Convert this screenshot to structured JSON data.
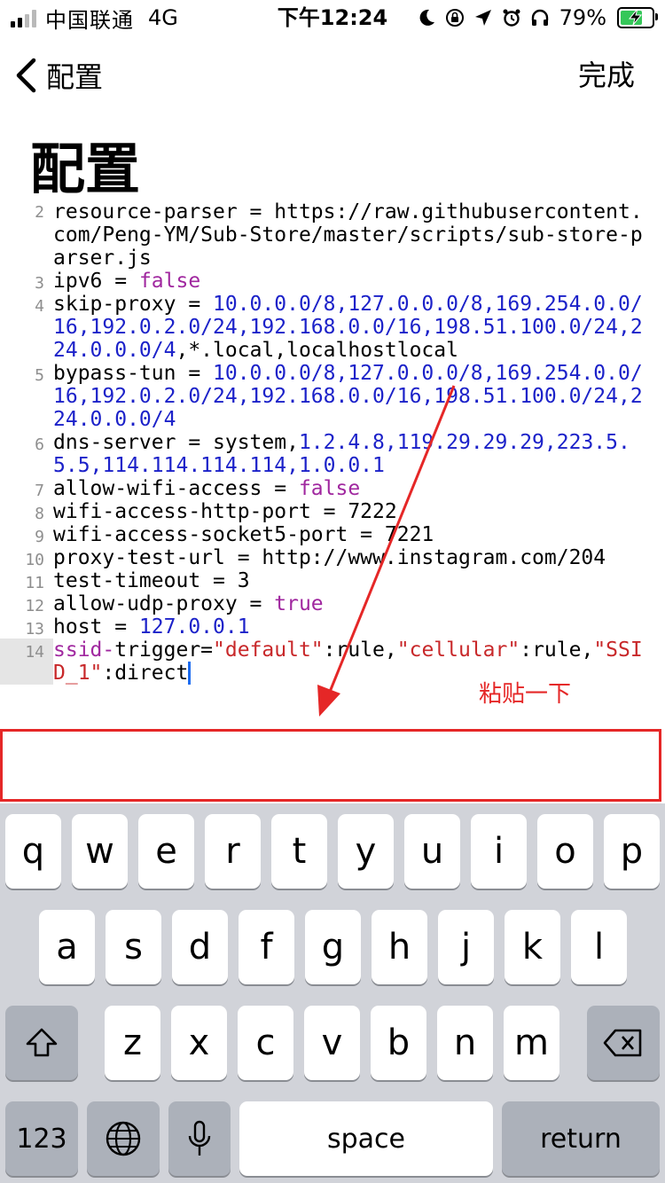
{
  "status_bar": {
    "carrier": "中国联通",
    "network": "4G",
    "time": "下午12:24",
    "battery_percent": "79%",
    "icons": [
      "moon-icon",
      "orientation-lock-icon",
      "location-arrow-icon",
      "alarm-icon",
      "headphones-icon"
    ]
  },
  "nav": {
    "back_label": "配置",
    "done_label": "完成"
  },
  "page_title": "配置",
  "editor": {
    "lines": [
      {
        "num": "2",
        "text": "resource-parser = https://raw.githubusercontent.com/Peng-YM/Sub-Store/master/scripts/sub-store-parser.js"
      },
      {
        "num": "3",
        "key": "ipv6 = ",
        "bool": "false"
      },
      {
        "num": "4",
        "key": "skip-proxy = ",
        "nums": "10.0.0.0/8,127.0.0.0/8,169.254.0.0/16,192.0.2.0/24,192.168.0.0/16,198.51.100.0/24,224.0.0.0/4",
        "tail": ",*.local,localhostlocal"
      },
      {
        "num": "5",
        "key": "bypass-tun = ",
        "nums": "10.0.0.0/8,127.0.0.0/8,169.254.0.0/16,192.0.2.0/24,192.168.0.0/16,198.51.100.0/24,224.0.0.0/4"
      },
      {
        "num": "6",
        "key": "dns-server = ",
        "pre": "system,",
        "nums": "1.2.4.8,119.29.29.29,223.5.5.5,114.114.114.114,1.0.0.1"
      },
      {
        "num": "7",
        "key": "allow-wifi-access = ",
        "bool": "false"
      },
      {
        "num": "8",
        "text": "wifi-access-http-port = 7222"
      },
      {
        "num": "9",
        "text": "wifi-access-socket5-port = 7221"
      },
      {
        "num": "10",
        "text": "proxy-test-url = http://www.instagram.com/204"
      },
      {
        "num": "11",
        "text": "test-timeout = 3"
      },
      {
        "num": "12",
        "key": "allow-udp-proxy = ",
        "bool": "true"
      },
      {
        "num": "13",
        "key": "host = ",
        "nums": "127.0.0.1"
      },
      {
        "num": "14",
        "kw": "ssid-",
        "rest1": "trigger=",
        "s1": "\"default\"",
        "r1": ":rule,",
        "s2": "\"cellular\"",
        "r2": ":rule,",
        "s3": "\"SSID_1\"",
        "r3": ":direct"
      }
    ]
  },
  "annotation": "粘贴一下",
  "colors": {
    "bool": "#a0279f",
    "number": "#1c22c9",
    "string": "#c8282a",
    "annotation": "#e52727",
    "cursor": "#1c6cf0"
  },
  "keyboard": {
    "row1": [
      "q",
      "w",
      "e",
      "r",
      "t",
      "y",
      "u",
      "i",
      "o",
      "p"
    ],
    "row2": [
      "a",
      "s",
      "d",
      "f",
      "g",
      "h",
      "j",
      "k",
      "l"
    ],
    "row3": [
      "z",
      "x",
      "c",
      "v",
      "b",
      "n",
      "m"
    ],
    "numbers_label": "123",
    "space_label": "space",
    "return_label": "return"
  }
}
